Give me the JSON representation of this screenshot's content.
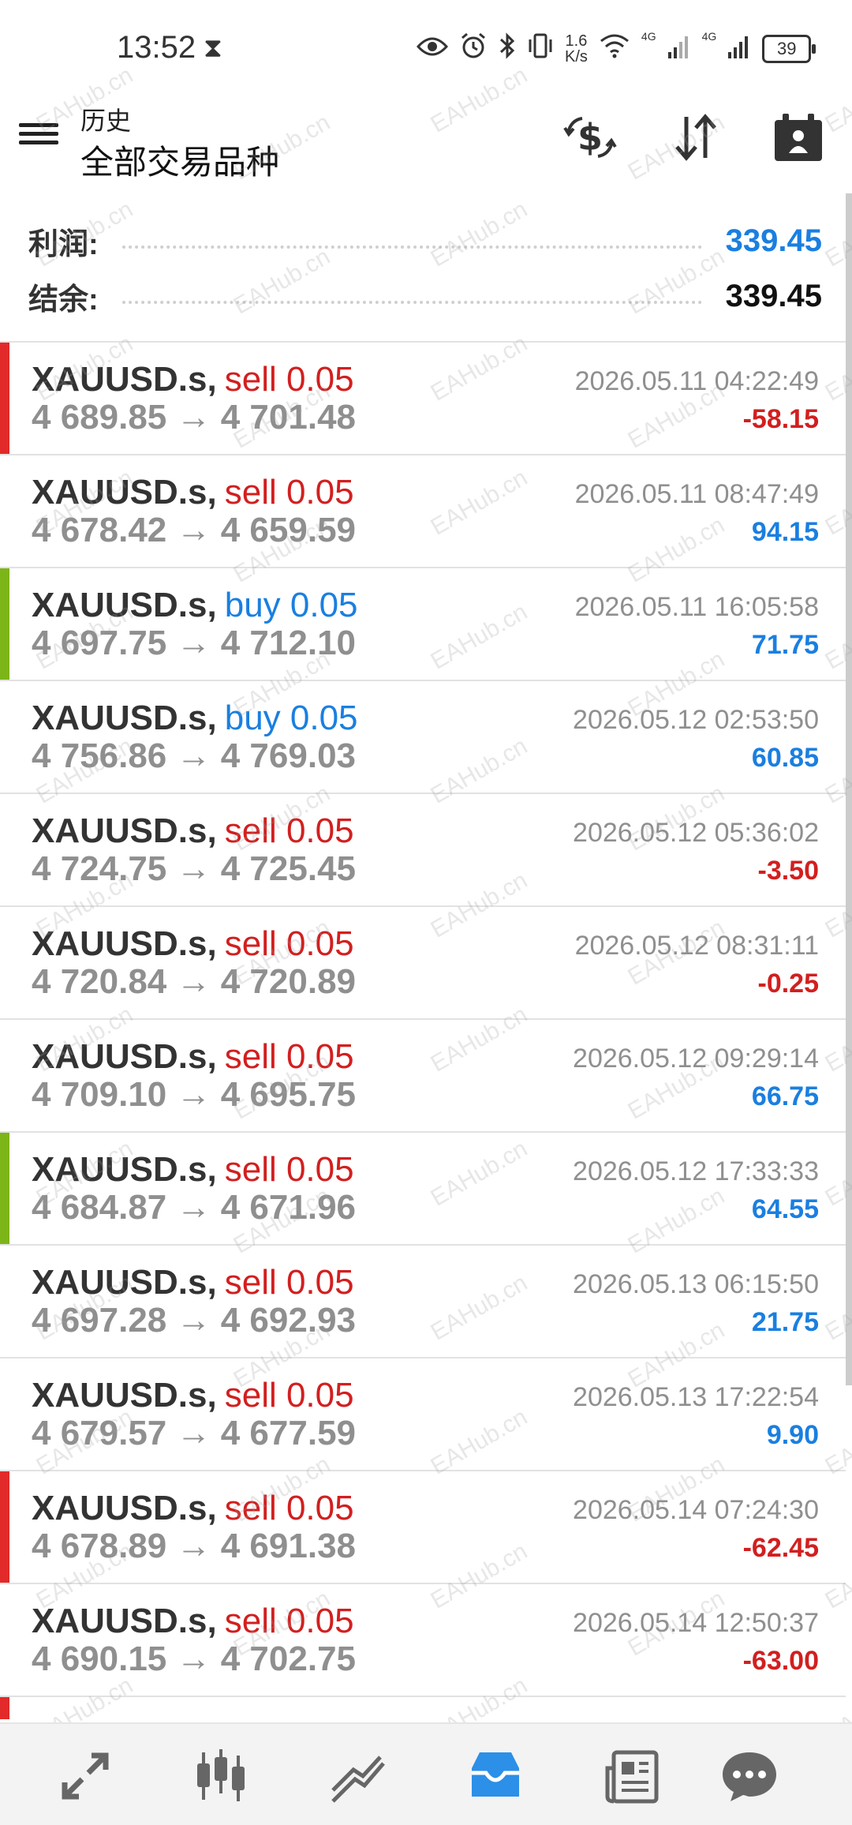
{
  "status_bar": {
    "time": "13:52",
    "net_speed_value": "1.6",
    "net_speed_unit": "K/s",
    "sig1": "4G",
    "sig2": "4G",
    "battery": "39"
  },
  "header": {
    "subtitle": "历史",
    "title": "全部交易品种",
    "icons": [
      "deposit-dollar-icon",
      "sort-icon",
      "calendar-icon"
    ]
  },
  "summary": {
    "profit_label": "利润:",
    "profit_value": "339.45",
    "balance_label": "结余:",
    "balance_value": "339.45"
  },
  "trades": [
    {
      "symbol": "XAUUSD.s,",
      "side": "sell 0.05",
      "side_type": "sell",
      "open": "4 689.85",
      "close": "4 701.48",
      "time": "2026.05.11 04:22:49",
      "profit": "-58.15",
      "profit_type": "loss",
      "bar": "#e32a2a"
    },
    {
      "symbol": "XAUUSD.s,",
      "side": "sell 0.05",
      "side_type": "sell",
      "open": "4 678.42",
      "close": "4 659.59",
      "time": "2026.05.11 08:47:49",
      "profit": "94.15",
      "profit_type": "gain",
      "bar": ""
    },
    {
      "symbol": "XAUUSD.s,",
      "side": "buy 0.05",
      "side_type": "buy",
      "open": "4 697.75",
      "close": "4 712.10",
      "time": "2026.05.11 16:05:58",
      "profit": "71.75",
      "profit_type": "gain",
      "bar": "#7cb518"
    },
    {
      "symbol": "XAUUSD.s,",
      "side": "buy 0.05",
      "side_type": "buy",
      "open": "4 756.86",
      "close": "4 769.03",
      "time": "2026.05.12 02:53:50",
      "profit": "60.85",
      "profit_type": "gain",
      "bar": ""
    },
    {
      "symbol": "XAUUSD.s,",
      "side": "sell 0.05",
      "side_type": "sell",
      "open": "4 724.75",
      "close": "4 725.45",
      "time": "2026.05.12 05:36:02",
      "profit": "-3.50",
      "profit_type": "loss",
      "bar": ""
    },
    {
      "symbol": "XAUUSD.s,",
      "side": "sell 0.05",
      "side_type": "sell",
      "open": "4 720.84",
      "close": "4 720.89",
      "time": "2026.05.12 08:31:11",
      "profit": "-0.25",
      "profit_type": "loss",
      "bar": ""
    },
    {
      "symbol": "XAUUSD.s,",
      "side": "sell 0.05",
      "side_type": "sell",
      "open": "4 709.10",
      "close": "4 695.75",
      "time": "2026.05.12 09:29:14",
      "profit": "66.75",
      "profit_type": "gain",
      "bar": ""
    },
    {
      "symbol": "XAUUSD.s,",
      "side": "sell 0.05",
      "side_type": "sell",
      "open": "4 684.87",
      "close": "4 671.96",
      "time": "2026.05.12 17:33:33",
      "profit": "64.55",
      "profit_type": "gain",
      "bar": "#7cb518"
    },
    {
      "symbol": "XAUUSD.s,",
      "side": "sell 0.05",
      "side_type": "sell",
      "open": "4 697.28",
      "close": "4 692.93",
      "time": "2026.05.13 06:15:50",
      "profit": "21.75",
      "profit_type": "gain",
      "bar": ""
    },
    {
      "symbol": "XAUUSD.s,",
      "side": "sell 0.05",
      "side_type": "sell",
      "open": "4 679.57",
      "close": "4 677.59",
      "time": "2026.05.13 17:22:54",
      "profit": "9.90",
      "profit_type": "gain",
      "bar": ""
    },
    {
      "symbol": "XAUUSD.s,",
      "side": "sell 0.05",
      "side_type": "sell",
      "open": "4 678.89",
      "close": "4 691.38",
      "time": "2026.05.14 07:24:30",
      "profit": "-62.45",
      "profit_type": "loss",
      "bar": "#e32a2a"
    },
    {
      "symbol": "XAUUSD.s,",
      "side": "sell 0.05",
      "side_type": "sell",
      "open": "4 690.15",
      "close": "4 702.75",
      "time": "2026.05.14 12:50:37",
      "profit": "-63.00",
      "profit_type": "loss",
      "bar": ""
    },
    {
      "symbol": "XAUUSD.s,",
      "side": "sell 0.05",
      "side_type": "sell",
      "open": "",
      "close": "",
      "time": "",
      "profit": "",
      "profit_type": "loss",
      "bar": "#e32a2a"
    }
  ],
  "colors": {
    "sell": "#d21f1f",
    "buy": "#1a7fe0",
    "gain": "#1a7fe0",
    "loss": "#d21f1f",
    "active_nav": "#2c8fe8"
  },
  "watermark": "EAHub.cn",
  "bottom_nav": [
    {
      "icon": "quotes-icon",
      "active": false
    },
    {
      "icon": "chart-candles-icon",
      "active": false
    },
    {
      "icon": "trade-icon",
      "active": false
    },
    {
      "icon": "history-inbox-icon",
      "active": true
    },
    {
      "icon": "news-icon",
      "active": false
    },
    {
      "icon": "chat-icon",
      "active": false
    }
  ]
}
